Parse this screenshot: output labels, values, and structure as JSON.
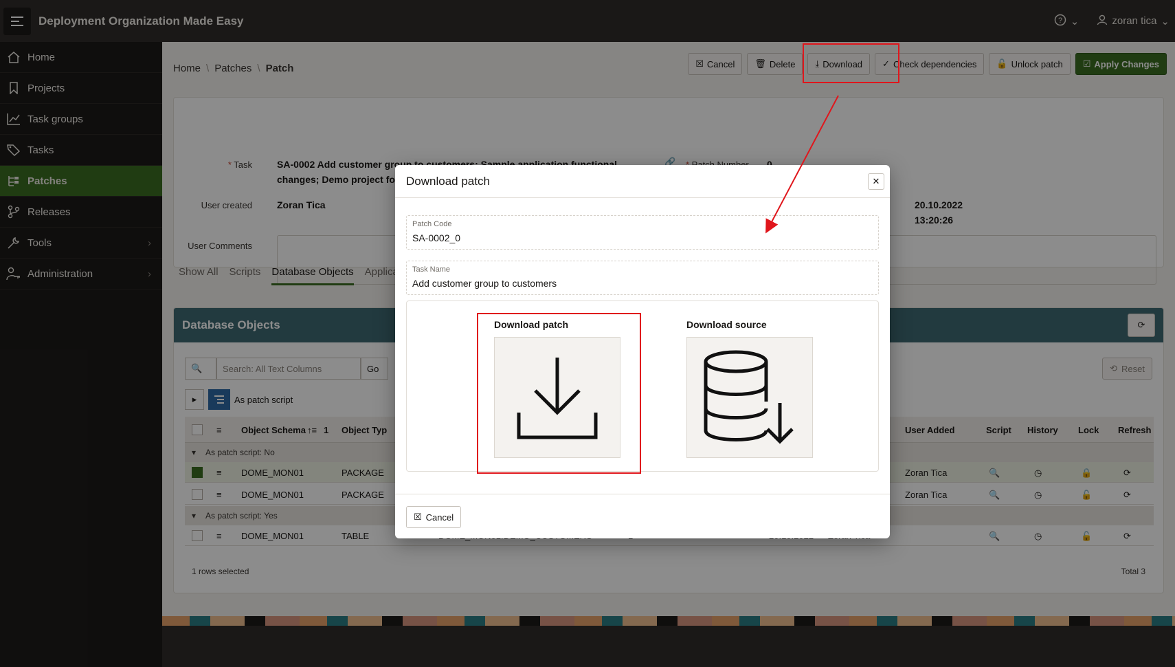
{
  "app": {
    "title": "Deployment Organization Made Easy",
    "help_icon": "help-icon",
    "user_name": "zoran tica"
  },
  "sidebar": {
    "items": [
      {
        "label": "Home",
        "icon": "home-icon"
      },
      {
        "label": "Projects",
        "icon": "bookmark-icon"
      },
      {
        "label": "Task groups",
        "icon": "chart-icon"
      },
      {
        "label": "Tasks",
        "icon": "tags-icon"
      },
      {
        "label": "Patches",
        "icon": "tree-icon",
        "active": true
      },
      {
        "label": "Releases",
        "icon": "branch-icon"
      },
      {
        "label": "Tools",
        "icon": "wrench-icon",
        "has_children": true
      },
      {
        "label": "Administration",
        "icon": "user-key-icon",
        "has_children": true
      }
    ]
  },
  "breadcrumb": [
    "Home",
    "Patches",
    "Patch"
  ],
  "toolbar": {
    "cancel": "Cancel",
    "delete": "Delete",
    "download": "Download",
    "check_dependencies": "Check dependencies",
    "unlock_patch": "Unlock patch",
    "apply_changes": "Apply Changes"
  },
  "form": {
    "task_label": "Task",
    "task_value_line1": "SA-0002 Add customer group to customers; Sample application functional",
    "task_value_line2": "changes; Demo project for documentation",
    "patch_number_label": "Patch Number",
    "patch_number_value": "0",
    "user_created_label": "User created",
    "user_created_value": "Zoran Tica",
    "date_value_line1": "20.10.2022",
    "date_value_line2": "13:20:26",
    "comments_label": "User Comments"
  },
  "tabs": [
    "Show All",
    "Scripts",
    "Database Objects",
    "Applicatio"
  ],
  "active_tab": 2,
  "region": {
    "title": "Database Objects",
    "search_placeholder": "Search: All Text Columns",
    "go": "Go",
    "reset": "Reset",
    "filter_chip": "As patch script",
    "columns": {
      "schema": "Object Schema",
      "schema_sort": "1",
      "type": "Object Typ",
      "user_added": "User Added",
      "script": "Script",
      "history": "History",
      "lock": "Lock",
      "refresh": "Refresh"
    },
    "group_no": "As patch script: No",
    "group_yes": "As patch script: Yes",
    "rows": [
      {
        "schema": "DOME_MON01",
        "type": "PACKAGE",
        "user": "Zoran Tica"
      },
      {
        "schema": "DOME_MON01",
        "type": "PACKAGE",
        "user": "Zoran Tica"
      },
      {
        "schema": "DOME_MON01",
        "type": "TABLE",
        "name": "DOME_MON01.DEMO_CUSTOMERS",
        "num": "1",
        "date": "20.10.2022",
        "user": "Zoran Tica"
      }
    ],
    "rows_selected": "1 rows selected",
    "total": "Total 3"
  },
  "dialog": {
    "title": "Download patch",
    "patch_code_label": "Patch Code",
    "patch_code_value": "SA-0002_0",
    "task_name_label": "Task Name",
    "task_name_value": "Add customer group to customers",
    "card_patch": "Download patch",
    "card_source": "Download source",
    "cancel": "Cancel"
  },
  "colors": {
    "accent_green": "#3b6e22",
    "header_dark": "#312d2a",
    "annotation_red": "#e0161c"
  }
}
